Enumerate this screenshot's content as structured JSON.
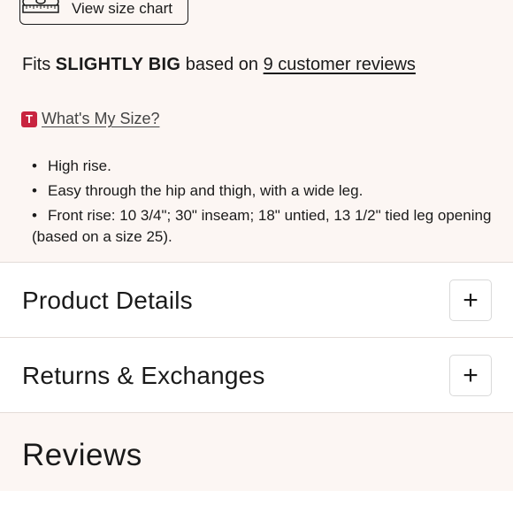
{
  "size_chart": {
    "label": "View size chart",
    "icon": "tape-measure-icon"
  },
  "fit": {
    "prefix": "Fits",
    "verdict": "SLIGHTLY BIG",
    "middle": "based on",
    "reviews_link": "9 customer reviews"
  },
  "size_help": {
    "badge": "T",
    "link": "What's My Size?",
    "badge_color": "#c8243f"
  },
  "details": [
    "High rise.",
    "Easy through the hip and thigh, with a wide leg.",
    "Front rise: 10 3/4\"; 30\" inseam; 18\" untied, 13 1/2\" tied leg opening (based on a size 25)."
  ],
  "accordions": [
    {
      "title": "Product Details",
      "toggle": "+"
    },
    {
      "title": "Returns & Exchanges",
      "toggle": "+"
    }
  ],
  "reviews": {
    "title": "Reviews"
  },
  "colors": {
    "panel_bg": "#fcf6f3",
    "text": "#1a1a1a"
  }
}
